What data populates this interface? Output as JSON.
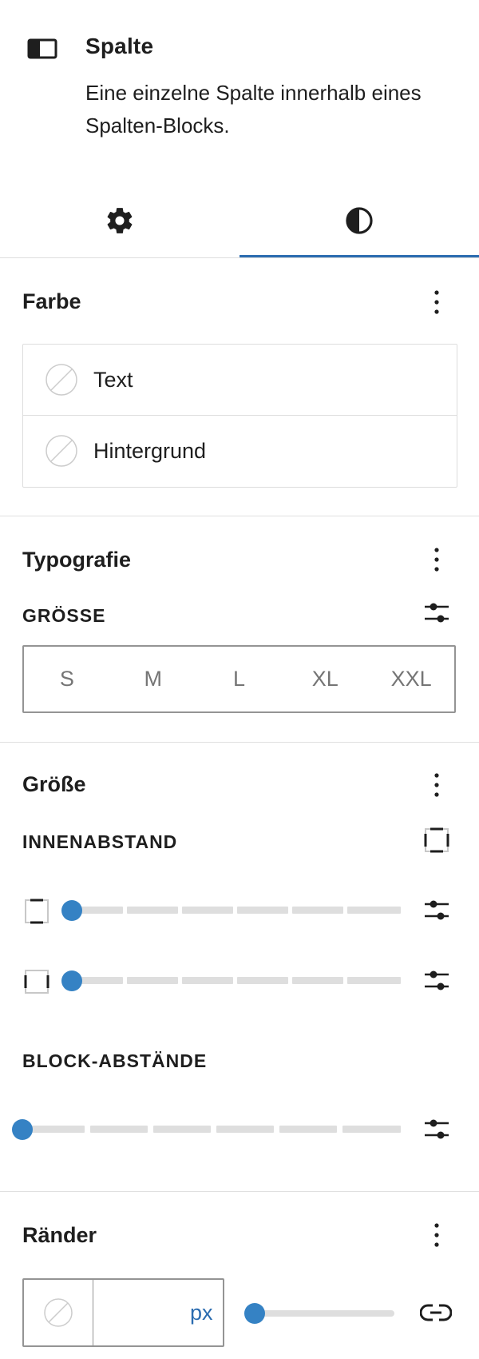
{
  "block": {
    "title": "Spalte",
    "description": "Eine einzelne Spalte innerhalb eines Spalten-Blocks.",
    "icon": "column-icon"
  },
  "tabs": [
    {
      "name": "settings",
      "icon": "gear-icon",
      "active": false
    },
    {
      "name": "styles",
      "icon": "contrast-icon",
      "active": true
    }
  ],
  "colors": {
    "accent": "#3582c4",
    "tab_indicator": "#2b6cb0",
    "border": "#949494",
    "divider": "#e0e0e0"
  },
  "panels": {
    "color": {
      "title": "Farbe",
      "items": [
        {
          "label": "Text",
          "icon": "no-color-icon"
        },
        {
          "label": "Hintergrund",
          "icon": "no-color-icon"
        }
      ]
    },
    "typography": {
      "title": "Typografie",
      "size_label": "GRÖSSE",
      "size_options": [
        "S",
        "M",
        "L",
        "XL",
        "XXL"
      ]
    },
    "dimensions": {
      "title": "Größe",
      "padding_label": "INNENABSTAND",
      "block_spacing_label": "BLOCK-ABSTÄNDE",
      "padding_vertical_value": 0,
      "padding_horizontal_value": 0,
      "block_spacing_value": 0
    },
    "borders": {
      "title": "Ränder",
      "width_value": "",
      "unit": "px",
      "radius_value": 0
    }
  }
}
